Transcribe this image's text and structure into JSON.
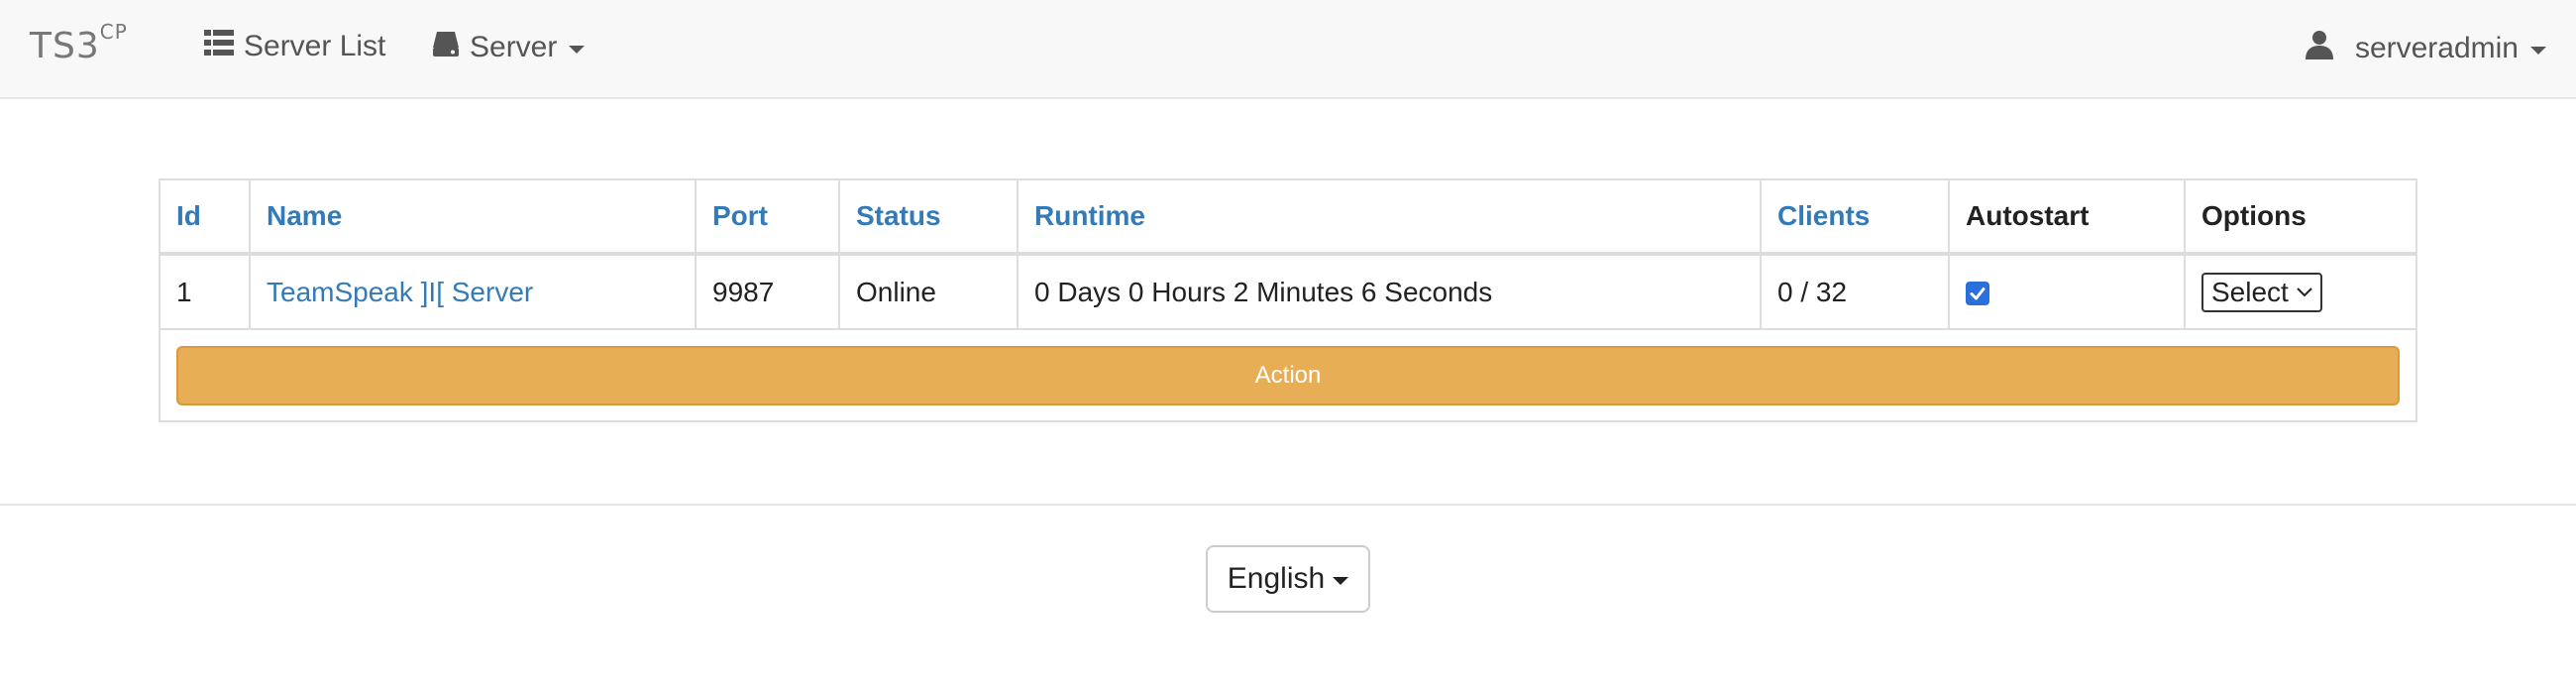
{
  "navbar": {
    "brand_main": "TS3",
    "brand_sup": "CP",
    "server_list_label": "Server List",
    "server_label": "Server",
    "user_label": "serveradmin",
    "icons": {
      "server_list": "list-icon",
      "server": "hard-drive-icon",
      "user": "user-icon"
    }
  },
  "table": {
    "headers": {
      "id": "Id",
      "name": "Name",
      "port": "Port",
      "status": "Status",
      "runtime": "Runtime",
      "clients": "Clients",
      "autostart": "Autostart",
      "options": "Options"
    },
    "rows": [
      {
        "id": "1",
        "name": "TeamSpeak ]I[ Server",
        "port": "9987",
        "status": "Online",
        "runtime": "0 Days 0 Hours 2 Minutes 6 Seconds",
        "clients": "0 / 32",
        "autostart": true,
        "option_selected": "Select"
      }
    ],
    "action_label": "Action"
  },
  "footer": {
    "language": "English"
  },
  "colors": {
    "link": "#337ab7",
    "action": "#e8ae55",
    "checkbox": "#2a6fdb"
  }
}
